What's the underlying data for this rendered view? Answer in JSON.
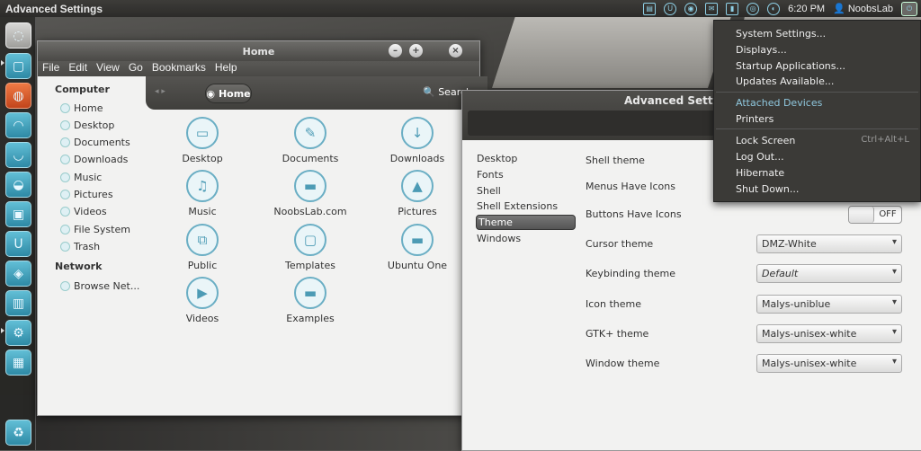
{
  "panel": {
    "app_title": "Advanced Settings",
    "clock": "6:20 PM",
    "user": "NoobsLab"
  },
  "launcher": {
    "items": [
      "dash-icon",
      "files-icon",
      "firefox-icon",
      "app-icon",
      "app-icon",
      "app-icon",
      "app-icon",
      "ubuntu-one-icon",
      "app-icon",
      "app-icon",
      "workspace-icon",
      "trash-icon"
    ]
  },
  "nautilus": {
    "title": "Home",
    "menu": [
      "File",
      "Edit",
      "View",
      "Go",
      "Bookmarks",
      "Help"
    ],
    "location": "Home",
    "search": "Search",
    "sidebar": {
      "computer_header": "Computer",
      "computer": [
        "Home",
        "Desktop",
        "Documents",
        "Downloads",
        "Music",
        "Pictures",
        "Videos",
        "File System",
        "Trash"
      ],
      "network_header": "Network",
      "network": [
        "Browse Net..."
      ]
    },
    "items": [
      "Desktop",
      "Documents",
      "Downloads",
      "Music",
      "NoobsLab.com",
      "Pictures",
      "Public",
      "Templates",
      "Ubuntu One",
      "Videos",
      "Examples"
    ]
  },
  "advanced": {
    "title": "Advanced Settings",
    "nav": [
      "Desktop",
      "Fonts",
      "Shell",
      "Shell Extensions",
      "Theme",
      "Windows"
    ],
    "selected_nav": "Theme",
    "labels": [
      "Shell theme",
      "Menus Have Icons",
      "Buttons Have Icons",
      "Cursor theme",
      "Keybinding theme",
      "Icon theme",
      "GTK+ theme",
      "Window theme"
    ],
    "toggle": "OFF",
    "combos": [
      "DMZ-White",
      "Default",
      "Malys-uniblue",
      "Malys-unisex-white",
      "Malys-unisex-white"
    ]
  },
  "system_menu": {
    "items": [
      "System Settings...",
      "Displays...",
      "Startup Applications...",
      "Updates Available...",
      "Attached Devices",
      "Printers",
      "Lock Screen",
      "Log Out...",
      "Hibernate",
      "Shut Down..."
    ],
    "lock_accel": "Ctrl+Alt+L"
  }
}
